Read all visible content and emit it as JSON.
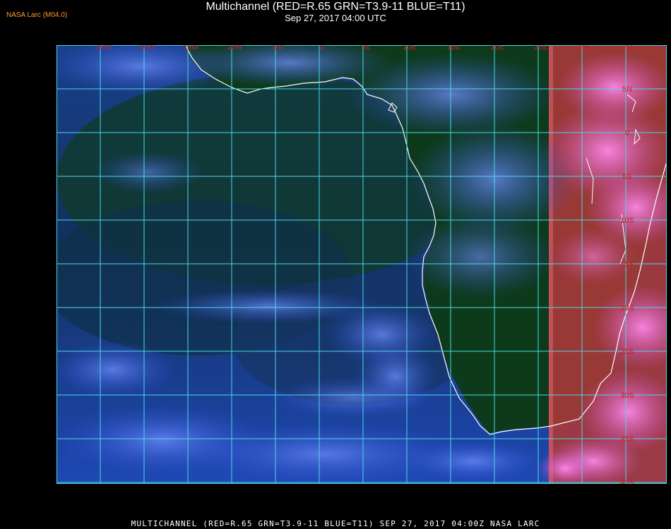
{
  "header": {
    "title": "Multichannel (RED=R.65 GRN=T3.9-11 BLUE=T11)",
    "timestamp": "Sep 27, 2017 04:00 UTC",
    "provider": "NASA Larc (M04.0)"
  },
  "footer": {
    "caption": "MULTICHANNEL (RED=R.65 GRN=T3.9-11 BLUE=T11) SEP 27, 2017 04:00Z   NASA LARC"
  },
  "map": {
    "longitude_labels": [
      "25W",
      "20W",
      "15W",
      "10W",
      "5W",
      "0",
      "5E",
      "10E",
      "15E",
      "20E",
      "25E",
      "30E",
      "35E"
    ],
    "latitude_labels": [
      "5N",
      "0",
      "5S",
      "10S",
      "15S",
      "20S",
      "25S",
      "30S",
      "35S",
      "40S"
    ],
    "colors": {
      "ocean": "#1c3c8a",
      "land_dark": "#123a1e",
      "grid": "#4ad8e8",
      "coastline": "#ffffff",
      "label": "#cc2222",
      "daylight_sector": "#b04040",
      "cloud_pink": "#e070d8",
      "cloud_light": "#8fb0ff"
    }
  }
}
